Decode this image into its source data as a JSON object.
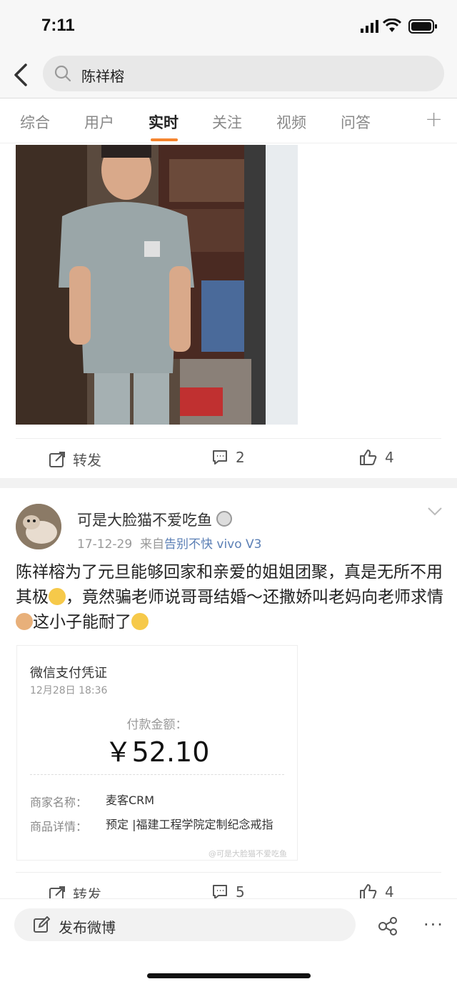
{
  "status_bar": {
    "time": "7:11"
  },
  "header": {
    "search_query": "陈祥榕"
  },
  "tabs": [
    {
      "label": "综合"
    },
    {
      "label": "用户"
    },
    {
      "label": "实时",
      "active": true
    },
    {
      "label": "关注"
    },
    {
      "label": "视频"
    },
    {
      "label": "问答"
    }
  ],
  "post1": {
    "actions": {
      "repost": "转发",
      "comments": "2",
      "likes": "4"
    }
  },
  "post2": {
    "username": "可是大脸猫不爱吃鱼",
    "date": "17-12-29",
    "source_prefix": "来自",
    "source": "告别不快 vivo V3",
    "text_1": "陈祥榕为了元旦能够回家和亲爱的姐姐团聚，真是无所不用其极",
    "text_2": "，竟然骗老师说哥哥结婚～还撒娇叫老妈向老师求情",
    "text_3": "这小子能耐了",
    "receipt": {
      "title": "微信支付凭证",
      "date": "12月28日 18:36",
      "amount_label": "付款金额：",
      "amount": "￥52.10",
      "merchant_key": "商家名称：",
      "merchant": "麦客CRM",
      "item_key": "商品详情：",
      "item": "预定 |福建工程学院定制纪念戒指"
    },
    "watermark": "@可是大脸猫不爱吃鱼",
    "actions": {
      "repost": "转发",
      "comments": "5",
      "likes": "4"
    }
  },
  "bottom_bar": {
    "compose_label": "发布微博"
  },
  "colors": {
    "accent": "#f5842e",
    "link": "#5b7fb5"
  }
}
